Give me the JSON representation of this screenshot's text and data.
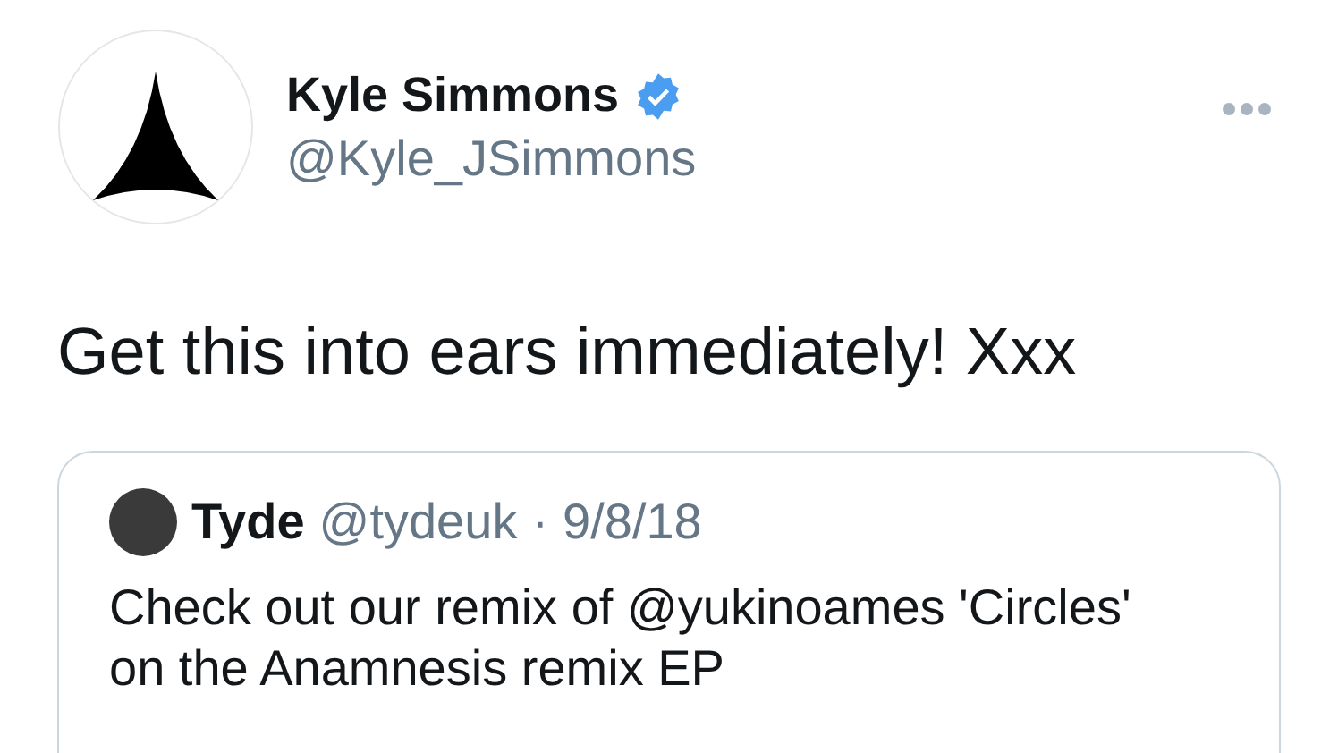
{
  "tweet": {
    "author": {
      "name": "Kyle Simmons",
      "verified": true,
      "handle": "@Kyle_JSimmons"
    },
    "text": "Get this into ears immediately! Xxx",
    "quoted": {
      "name": "Tyde",
      "handle": "@tydeuk",
      "separator": "·",
      "date": "9/8/18",
      "text": "Check out our remix of @yukinoames 'Circles' on the Anamnesis remix EP"
    }
  }
}
